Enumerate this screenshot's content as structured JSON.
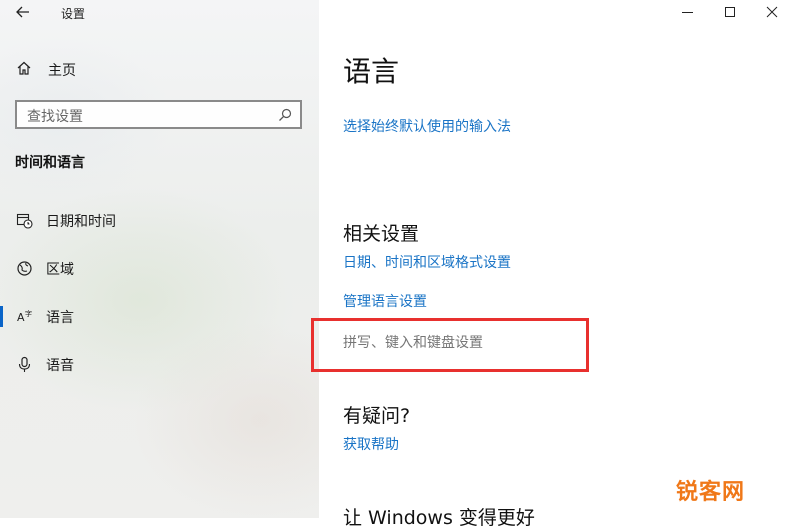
{
  "window": {
    "title": "设置",
    "controls": {
      "minimize": "minimize-icon",
      "maximize": "maximize-icon",
      "close": "close-icon"
    }
  },
  "sidebar": {
    "home_label": "主页",
    "search_placeholder": "查找设置",
    "section_title": "时间和语言",
    "items": [
      {
        "label": "日期和时间",
        "icon": "calendar-clock-icon",
        "selected": false
      },
      {
        "label": "区域",
        "icon": "globe-icon",
        "selected": false
      },
      {
        "label": "语言",
        "icon": "language-icon",
        "selected": true
      },
      {
        "label": "语音",
        "icon": "microphone-icon",
        "selected": false
      }
    ]
  },
  "main": {
    "title": "语言",
    "choose_input_link": "选择始终默认使用的输入法",
    "related_heading": "相关设置",
    "related_links": [
      "日期、时间和区域格式设置",
      "管理语言设置"
    ],
    "spelling_link": "拼写、键入和键盘设置",
    "question_heading": "有疑问?",
    "help_link": "获取帮助",
    "improve_heading": "让 Windows 变得更好"
  },
  "watermark": "锐客网",
  "colors": {
    "link": "#1a74c6",
    "accent": "#0a64c8",
    "highlight": "#e8302e",
    "watermark": "#f07818"
  }
}
